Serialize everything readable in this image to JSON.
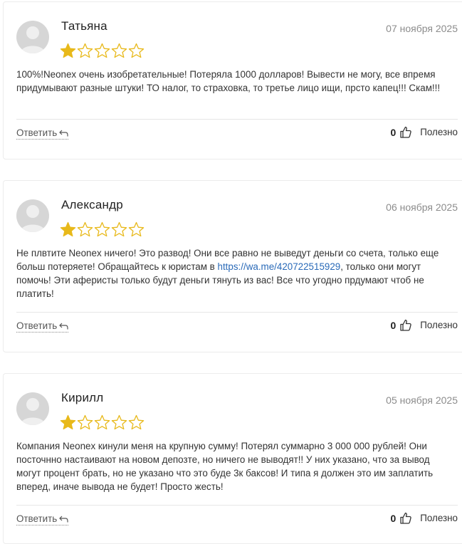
{
  "reviews": [
    {
      "author": "Татьяна",
      "date": "07 ноября 2025",
      "rating": 1,
      "max_rating": 5,
      "text_parts": [
        "100%!Neonex очень изобретательные! Потеряла 1000 долларов! Вывеcти не могу, все впремя придумывают разные штуки! ТО налог, то страховка, то третье лицо ищи, прсто капец!!! Скам!!!"
      ],
      "reply_label": "Ответить",
      "likes": "0",
      "useful_label": "Полезно"
    },
    {
      "author": "Александр",
      "date": "06 ноября 2025",
      "rating": 1,
      "max_rating": 5,
      "text_before_link": "Не плвтите Neonex ничего! Это развод! Они все равно не выведут деньги со счета, только еще больш потеряете! Обращайтесь к юристам в ",
      "link_text": "https://wa.me/420722515929",
      "text_after_link": ", только они могут помочь! Эти аферисты только будут деньги тянуть из вас! Все что угодно прдумают чтоб не платить!",
      "reply_label": "Ответить",
      "likes": "0",
      "useful_label": "Полезно"
    },
    {
      "author": "Кирилл",
      "date": "05 ноября 2025",
      "rating": 1,
      "max_rating": 5,
      "text_parts": [
        "Компания Neonex кинули меня на крупную сумму! Потерял суммарно 3 000 000 рублей! Они посточнно настаивают на новом депозте, но ничего не выводят!! У них указано, что за вывод могут процент брать, но не указано что это буде 3к баксов! И типа я должен это им заплатить вперед, иначе вывода не будет! Просто жесть!"
      ],
      "reply_label": "Ответить",
      "likes": "0",
      "useful_label": "Полезно"
    }
  ],
  "colors": {
    "star_filled": "#e8b91a",
    "star_empty_stroke": "#e8b91a",
    "link": "#2a6ab8",
    "date": "#8c8c8c"
  },
  "icons": {
    "reply": "reply-arrow-icon",
    "like": "thumbs-up-icon",
    "avatar": "user-avatar-icon"
  }
}
